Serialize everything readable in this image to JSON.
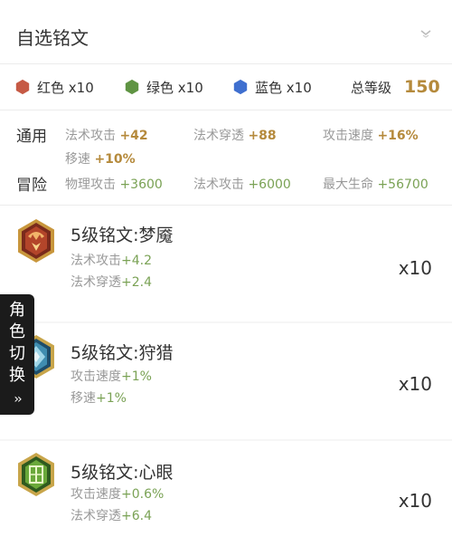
{
  "header": {
    "title": "自选铭文"
  },
  "summary": {
    "items": [
      {
        "label": "红色 x10",
        "color": "#c65a45"
      },
      {
        "label": "绿色 x10",
        "color": "#5f9443"
      },
      {
        "label": "蓝色 x10",
        "color": "#3f6fcf"
      }
    ],
    "total_label": "总等级",
    "total_value": "150"
  },
  "stats": {
    "general": {
      "title": "通用",
      "items": [
        {
          "name": "法术攻击",
          "value": "+42"
        },
        {
          "name": "法术穿透",
          "value": "+88"
        },
        {
          "name": "攻击速度",
          "value": "+16%"
        },
        {
          "name": "移速",
          "value": "+10%"
        }
      ]
    },
    "adventure": {
      "title": "冒险",
      "items": [
        {
          "name": "物理攻击",
          "value": "+3600"
        },
        {
          "name": "法术攻击",
          "value": "+6000"
        },
        {
          "name": "最大生命",
          "value": "+56700"
        }
      ]
    }
  },
  "runes": [
    {
      "name": "5级铭文:梦魇",
      "stats": [
        {
          "name": "法术攻击",
          "value": "+4.2"
        },
        {
          "name": "法术穿透",
          "value": "+2.4"
        }
      ],
      "count": "x10",
      "icon": "red-rune-icon"
    },
    {
      "name": "5级铭文:狩猎",
      "stats": [
        {
          "name": "攻击速度",
          "value": "+1%"
        },
        {
          "name": "移速",
          "value": "+1%"
        }
      ],
      "count": "x10",
      "icon": "blue-rune-icon"
    },
    {
      "name": "5级铭文:心眼",
      "stats": [
        {
          "name": "攻击速度",
          "value": "+0.6%"
        },
        {
          "name": "法术穿透",
          "value": "+6.4"
        }
      ],
      "count": "x10",
      "icon": "green-rune-icon"
    }
  ],
  "side_tab": {
    "chars": [
      "角",
      "色",
      "切",
      "换"
    ],
    "arrow": "››"
  }
}
